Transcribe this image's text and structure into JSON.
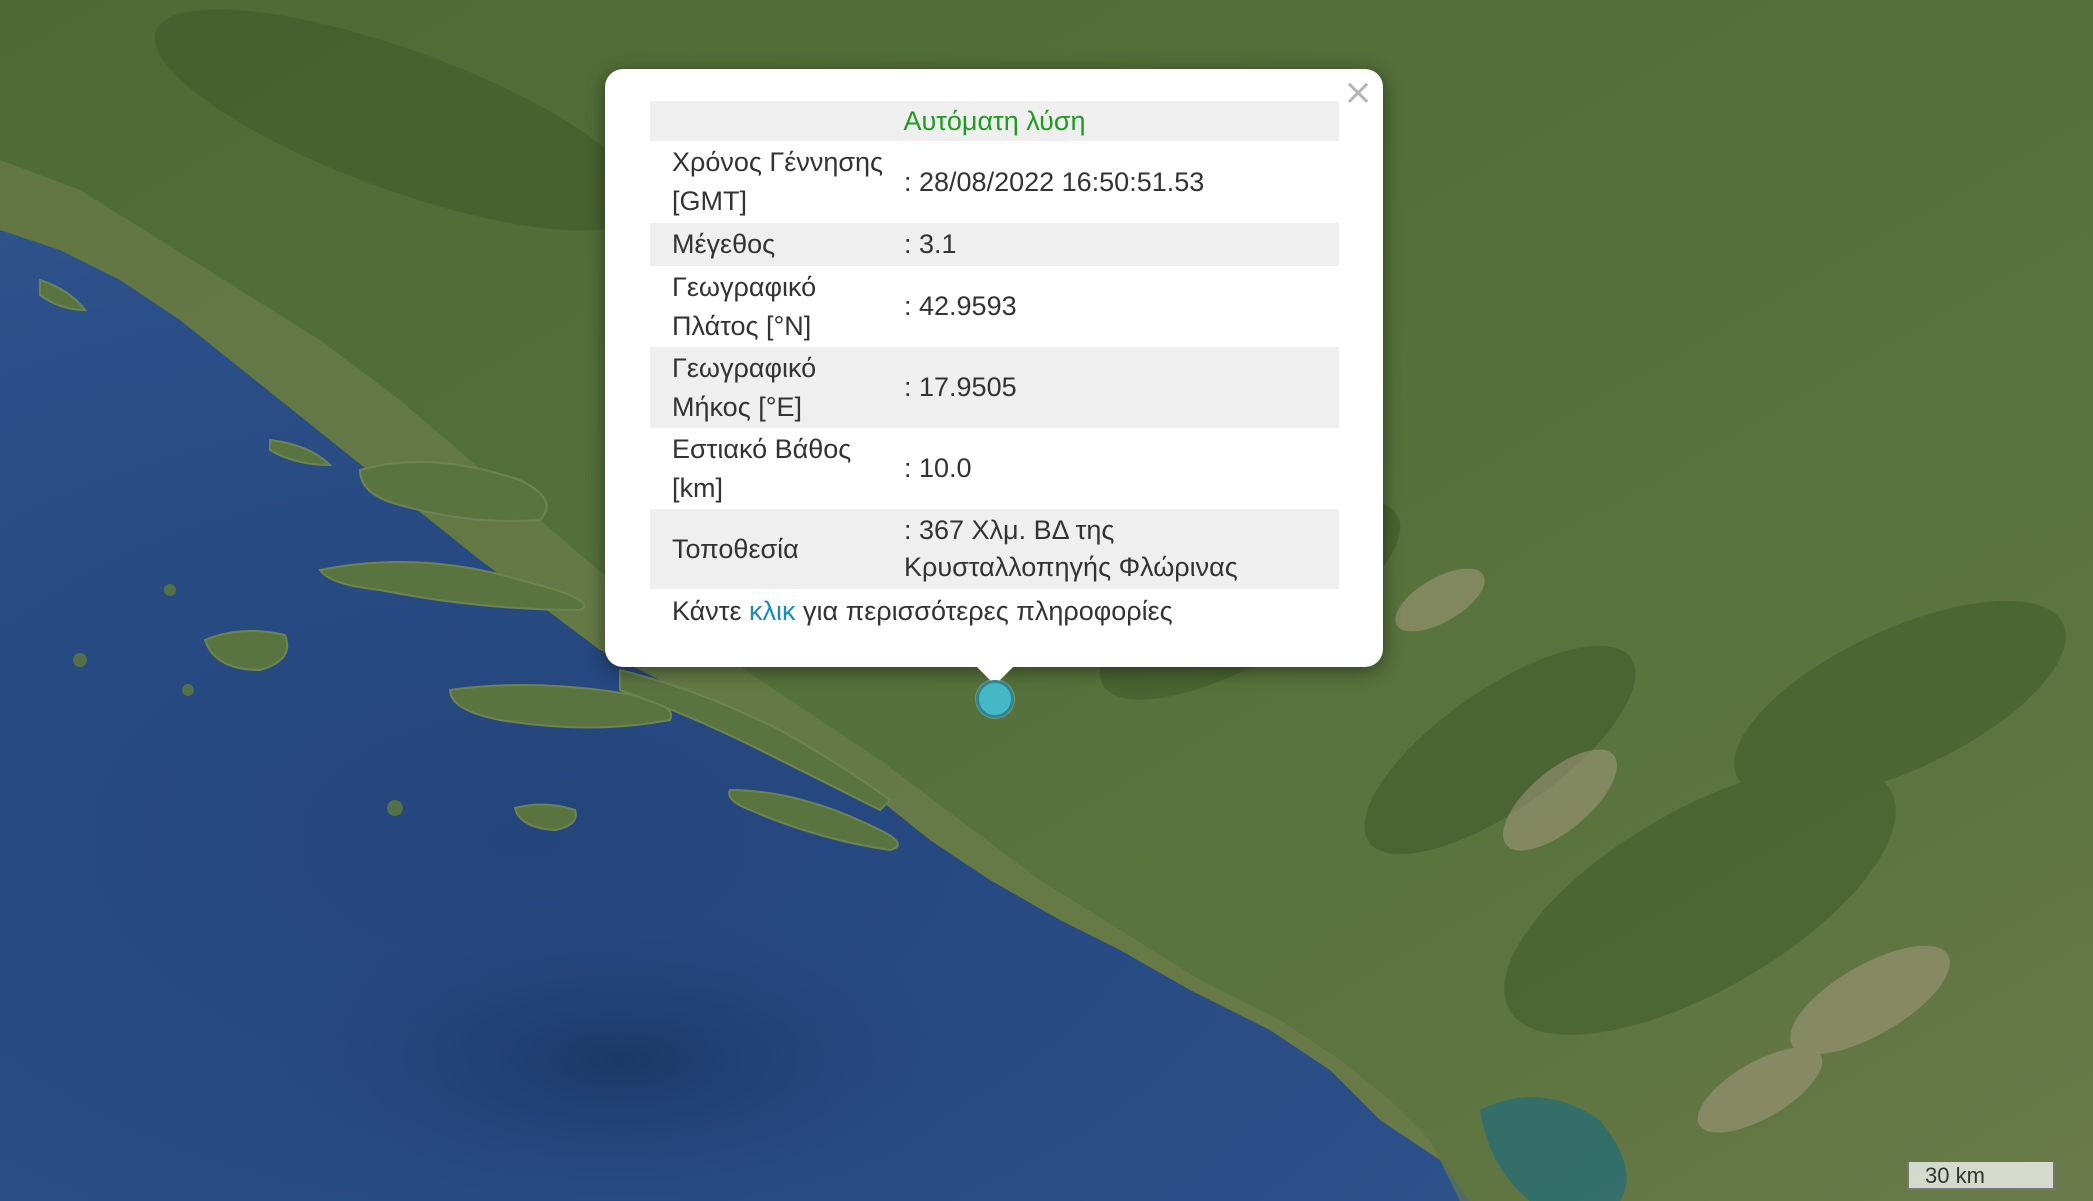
{
  "popup": {
    "title": "Αυτόματη λύση",
    "close_symbol": "×",
    "rows": [
      {
        "label_lines": [
          "Χρόνος Γέννησης",
          "[GMT]"
        ],
        "value_lines": [
          ": 28/08/2022 16:50:51.53"
        ]
      },
      {
        "label_lines": [
          "Μέγεθος"
        ],
        "value_lines": [
          ": 3.1"
        ]
      },
      {
        "label_lines": [
          "Γεωγραφικό",
          "Πλάτος [°N]"
        ],
        "value_lines": [
          ": 42.9593"
        ]
      },
      {
        "label_lines": [
          "Γεωγραφικό",
          "Μήκος [°E]"
        ],
        "value_lines": [
          ": 17.9505"
        ]
      },
      {
        "label_lines": [
          "Εστιακό Βάθος",
          "[km]"
        ],
        "value_lines": [
          ": 10.0"
        ]
      },
      {
        "label_lines": [
          "Τοποθεσία"
        ],
        "value_lines": [
          ": 367 Χλμ. ΒΔ της",
          "Κρυσταλλοπηγής Φλώρινας"
        ]
      }
    ],
    "more_prefix": "Κάντε ",
    "more_link": "κλικ",
    "more_suffix": " για περισσότερες πληροφορίες"
  },
  "scale_label": "30 km",
  "colors": {
    "sea": "#2c4f86",
    "land": "#55703a",
    "title_green": "#1f9b1f",
    "link_blue": "#1b8bb8",
    "marker": "#45b8c6"
  },
  "marker_icon": "epicenter-marker-icon"
}
